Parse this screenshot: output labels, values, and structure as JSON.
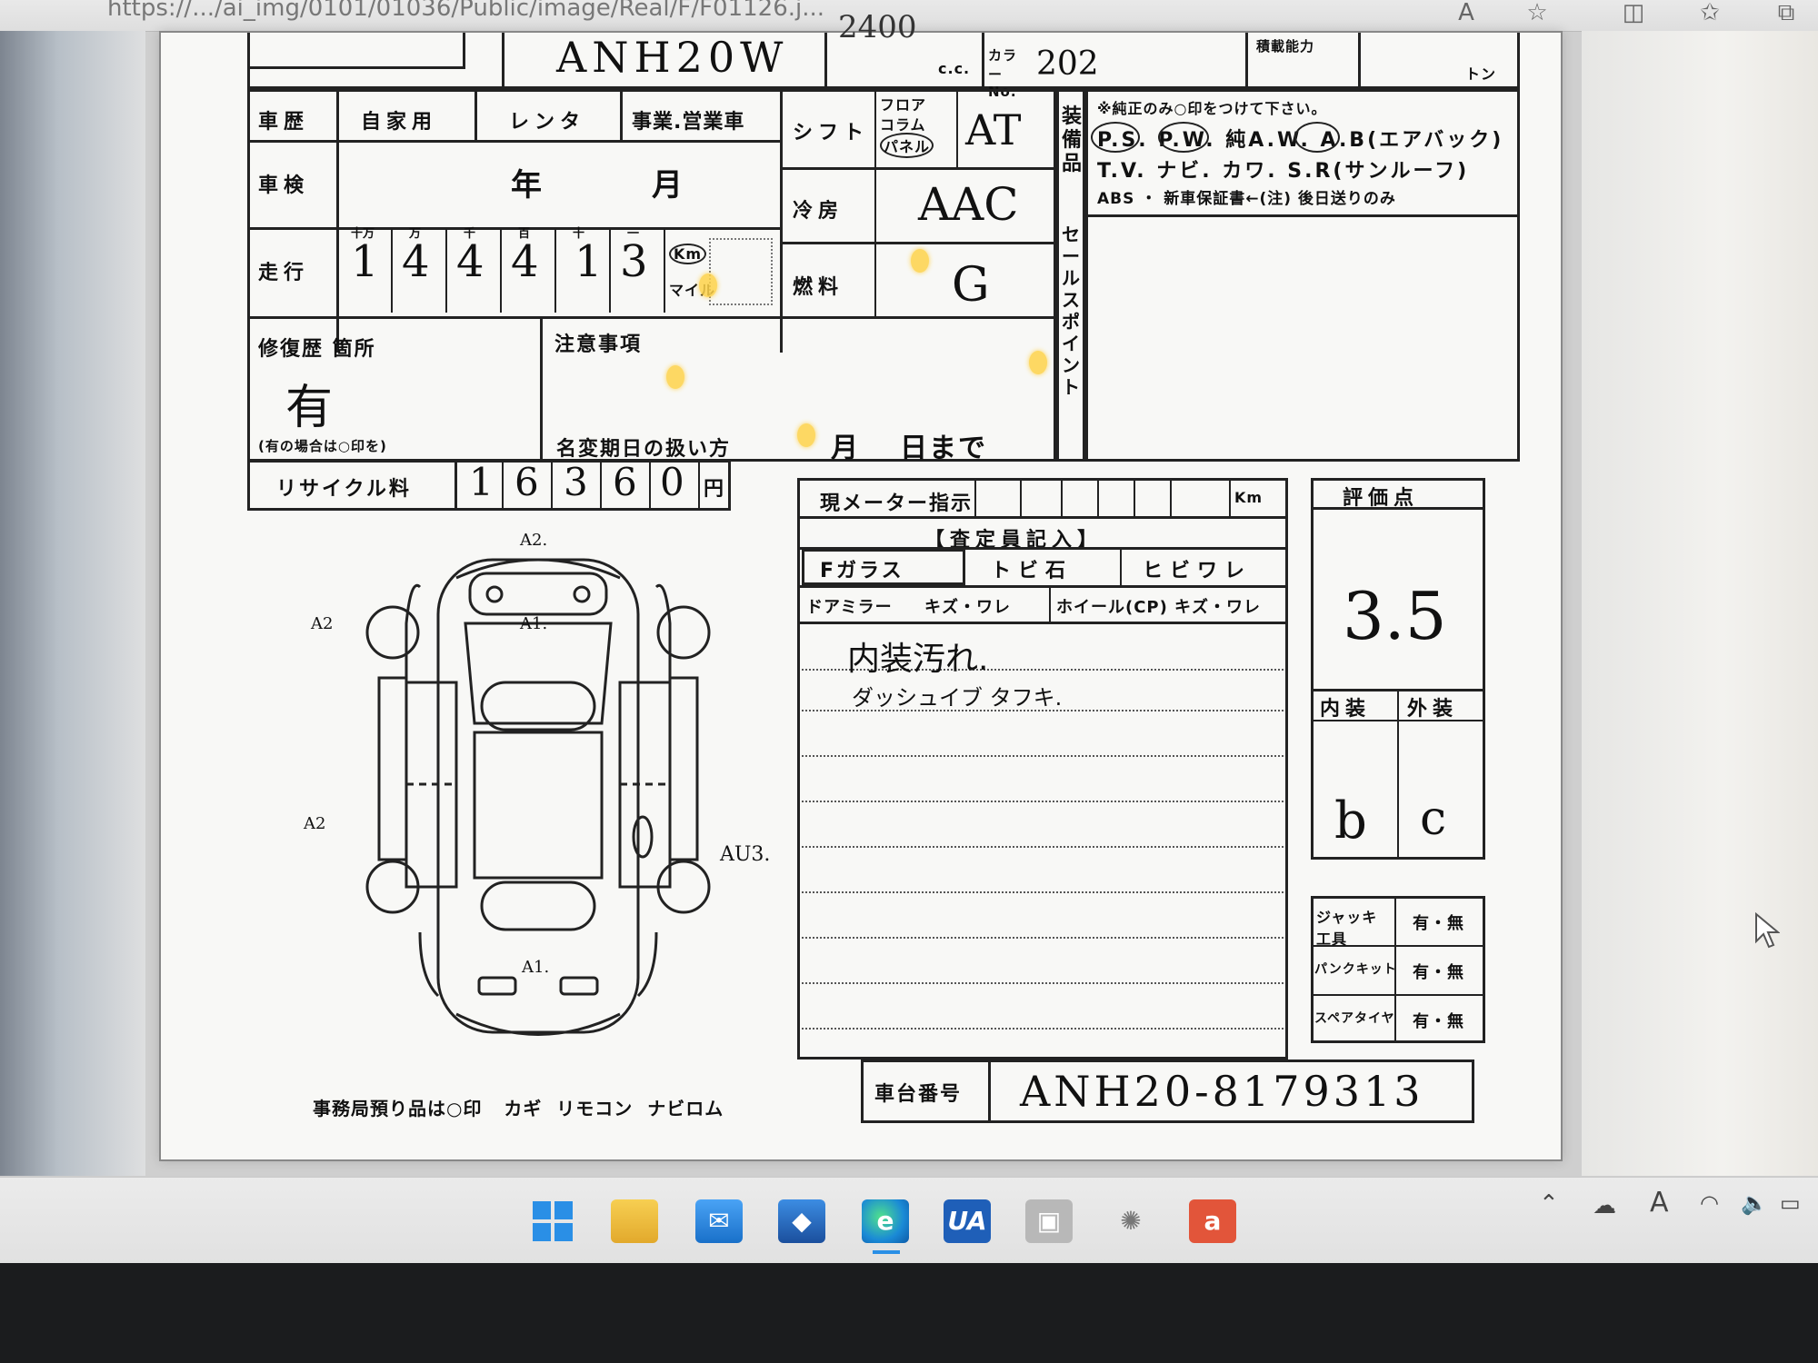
{
  "browser": {
    "url": "https://.../ai_img/0101/01036/Public/image/Real/F/F01126.j...",
    "icons": [
      "read-aloud-icon",
      "favorite-star-icon",
      "split-screen-icon",
      "favorites-icon",
      "collections-icon"
    ]
  },
  "sheet": {
    "model_code": "ANH20W",
    "cc_label": "c.c.",
    "cc_value": "2400",
    "color_label": "カラー No.",
    "color_value": "202",
    "capacity_label": "積載能力",
    "ton_label": "トン",
    "usage": {
      "label": "車歴",
      "options": [
        "自家用",
        "レンタ",
        "事業.営業車"
      ]
    },
    "inspection": {
      "label": "車検",
      "year": "年",
      "month": "月"
    },
    "mileage": {
      "label": "走行",
      "place_headers": [
        "十万",
        "万",
        "千",
        "百",
        "十",
        "一"
      ],
      "digits": [
        "1",
        "4",
        "4",
        "4",
        "1",
        "3"
      ],
      "unit_km": "Km",
      "unit_mile": "マイル"
    },
    "shift": {
      "label": "シフト",
      "type_options": [
        "フロア",
        "コラム",
        "パネル"
      ],
      "value": "AT"
    },
    "aircon": {
      "label": "冷房",
      "value": "AAC"
    },
    "fuel": {
      "label": "燃料",
      "value": "G"
    },
    "equipment": {
      "label": "装備品",
      "note": "※純正のみ○印をつけて下さい。",
      "line1": "P.S.  P.W.  純A.W.  A.B(エアバック)",
      "line2": "T.V.  ナビ.  カワ.  S.R(サンルーフ)",
      "line3": "ABS  ・  新車保証書←(注) 後日送りのみ"
    },
    "sales_point_label": "セールスポイント",
    "repair": {
      "label": "修復歴 箇所",
      "value": "有",
      "note": "(有の場合は○印を)"
    },
    "caution": {
      "label": "注意事項",
      "name_change": "名変期日の扱い方",
      "month": "月",
      "day": "日まで"
    },
    "recycle": {
      "label": "リサイクル料",
      "digits": [
        "1",
        "6",
        "3",
        "6",
        "0"
      ],
      "unit": "円"
    },
    "meter": {
      "label": "現メーター指示",
      "unit": "Km"
    },
    "inspector_heading": "【査定員記入】",
    "glass": {
      "label": "Fガラス",
      "opt1": "トビ石",
      "opt2": "ヒビワレ"
    },
    "mirror": {
      "label": "ドアミラー",
      "opt": "キズ・ワレ"
    },
    "wheel": {
      "label": "ホイール(CP)",
      "opt": "キズ・ワレ"
    },
    "notes": [
      "内装汚れ.",
      "ダッシュイブ タフキ."
    ],
    "score": {
      "label": "評価点",
      "value": "3.5",
      "interior_label": "内装",
      "exterior_label": "外装",
      "interior": "b",
      "exterior": "c"
    },
    "accessories": [
      {
        "label": "ジャッキ工具",
        "value": "有・無"
      },
      {
        "label": "パンクキット",
        "value": "有・無"
      },
      {
        "label": "スペアタイヤ",
        "value": "有・無"
      }
    ],
    "chassis": {
      "label": "車台番号",
      "value": "ANH20-8179313"
    },
    "office_items": "事務局預り品は○印   カギ  リモコン  ナビロム",
    "damage_marks": [
      "A2.",
      "A1.",
      "A2",
      "A2",
      "AU3.",
      "A1."
    ]
  },
  "taskbar": {
    "apps": [
      "start-icon",
      "file-explorer-icon",
      "mail-icon",
      "store-icon",
      "edge-icon",
      "ua-app-icon",
      "photo-app-icon",
      "settings-app-icon",
      "office-app-icon"
    ],
    "ua_label": "UA",
    "office_label": "a"
  }
}
